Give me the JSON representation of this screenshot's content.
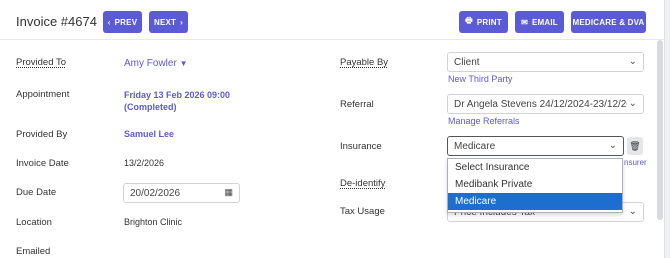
{
  "header": {
    "title": "Invoice #4674",
    "prev_label": "PREV",
    "next_label": "NEXT",
    "print_label": "PRINT",
    "email_label": "EMAIL",
    "medicare_label": "MEDICARE & DVA"
  },
  "left": {
    "provided_to_label": "Provided To",
    "provided_to_value": "Amy Fowler",
    "appointment_label": "Appointment",
    "appointment_line1": "Friday 13 Feb 2026 09:00",
    "appointment_line2": "(Completed)",
    "provided_by_label": "Provided By",
    "provided_by_value": "Samuel Lee",
    "invoice_date_label": "Invoice Date",
    "invoice_date_value": "13/2/2026",
    "due_date_label": "Due Date",
    "due_date_value": "20/02/2026",
    "location_label": "Location",
    "location_value": "Brighton Clinic",
    "emailed_label": "Emailed"
  },
  "right": {
    "payable_by_label": "Payable By",
    "payable_by_value": "Client",
    "new_third_party": "New Third Party",
    "referral_label": "Referral",
    "referral_value": "Dr Angela Stevens 24/12/2024-23/12/202",
    "manage_referrals": "Manage Referrals",
    "insurance_label": "Insurance",
    "insurance_value": "Medicare",
    "insurer_link_fragment": "nsurer",
    "deidentify_label": "De-identify",
    "tax_usage_label": "Tax Usage",
    "tax_usage_value": "Price Includes Tax",
    "insurance_options": [
      "Select Insurance",
      "Medibank Private",
      "Medicare"
    ]
  }
}
